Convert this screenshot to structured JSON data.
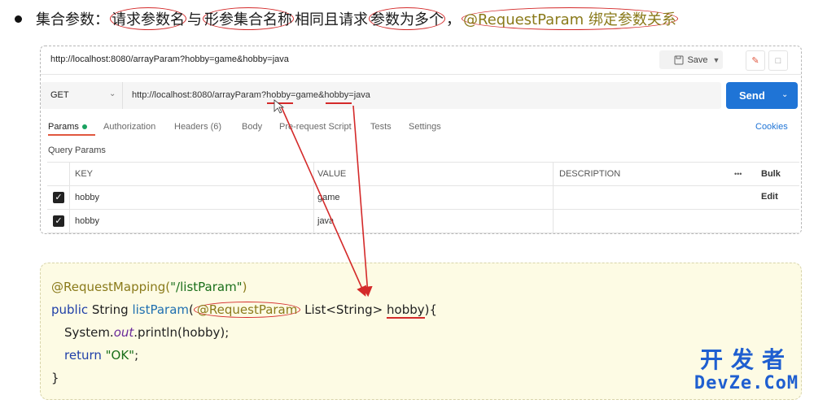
{
  "heading": {
    "segments": [
      {
        "text": "集合参数：",
        "style": "plain"
      },
      {
        "text": "请求参数名",
        "style": "circled"
      },
      {
        "text": "与",
        "style": "plain"
      },
      {
        "text": "形参集合名称",
        "style": "circled"
      },
      {
        "text": "相同且请求",
        "style": "plain"
      },
      {
        "text": "参数为多个",
        "style": "circled"
      },
      {
        "text": "，",
        "style": "plain"
      },
      {
        "text": "@RequestParam 绑定参数关系",
        "style": "circled-accent"
      }
    ]
  },
  "postman": {
    "tab_url": "http://localhost:8080/arrayParam?hobby=game&hobby=java",
    "save_label": "Save",
    "method": "GET",
    "request_url": "http://localhost:8080/arrayParam?hobby=game&hobby=java",
    "send_label": "Send",
    "tabs": [
      "Params",
      "Authorization",
      "Headers (6)",
      "Body",
      "Pre-request Script",
      "Tests",
      "Settings"
    ],
    "cookies_label": "Cookies",
    "query_params_title": "Query Params",
    "columns": [
      "KEY",
      "VALUE",
      "DESCRIPTION",
      "•••",
      "Bulk Edit"
    ],
    "rows": [
      {
        "key": "hobby",
        "value": "game",
        "description": "",
        "checked": true
      },
      {
        "key": "hobby",
        "value": "java",
        "description": "",
        "checked": true
      }
    ]
  },
  "code": {
    "line1": {
      "annotation": "@RequestMapping(",
      "string": "\"/listParam\"",
      "close": ")"
    },
    "line2": {
      "kw": "public",
      "type": " String ",
      "method": "listParam",
      "open": "(",
      "annotation": "@RequestParam",
      "rest": " List<String> ",
      "param": "hobby",
      "end": "){"
    },
    "line3": {
      "start": "System.",
      "italic": "out",
      "end": ".println(hobby);"
    },
    "line4": {
      "kw": "return ",
      "string": "\"OK\"",
      "end": ";"
    },
    "line5": "}"
  },
  "watermark": {
    "cn": "开发者",
    "en": "DevZe.CoM"
  },
  "colors": {
    "accent_red": "#d42a2a",
    "send_blue": "#1f74d6",
    "active_tab": "#e0573f",
    "watermark": "#1f5fd0"
  }
}
